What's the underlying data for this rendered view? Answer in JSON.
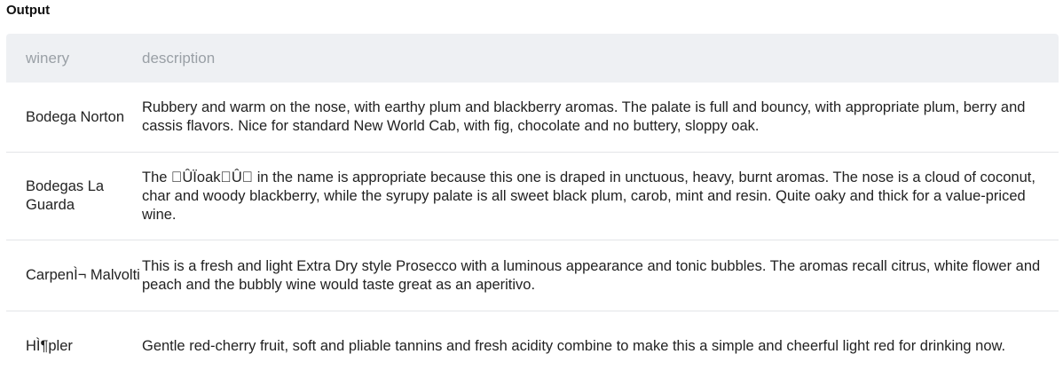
{
  "output_label": "Output",
  "table": {
    "columns": [
      "winery",
      "description"
    ],
    "rows": [
      {
        "winery": "Bodega Norton",
        "description": "Rubbery and warm on the nose, with earthy plum and blackberry aromas. The palate is full and bouncy, with appropriate plum, berry and cassis flavors. Nice for standard New World Cab, with fig, chocolate and no buttery, sloppy oak."
      },
      {
        "winery": "Bodegas La Guarda",
        "description": "The \u0000ÛÏoak\u0000Û\u0000 in the name is appropriate because this one is draped in unctuous, heavy, burnt aromas. The nose is a cloud of coconut, char and woody blackberry, while the syrupy palate is all sweet black plum, carob, mint and resin. Quite oaky and thick for a value-priced wine."
      },
      {
        "winery": "CarpenÌ¬ Malvolti",
        "description": "This is a fresh and light Extra Dry style Prosecco with a luminous appearance and tonic bubbles. The aromas recall citrus, white flower and peach and the bubbly wine would taste great as an aperitivo."
      },
      {
        "winery": "HÌ¶pler",
        "description": "Gentle red-cherry fruit, soft and pliable tannins and fresh acidity combine to make this a simple and cheerful light red for drinking now."
      }
    ]
  }
}
